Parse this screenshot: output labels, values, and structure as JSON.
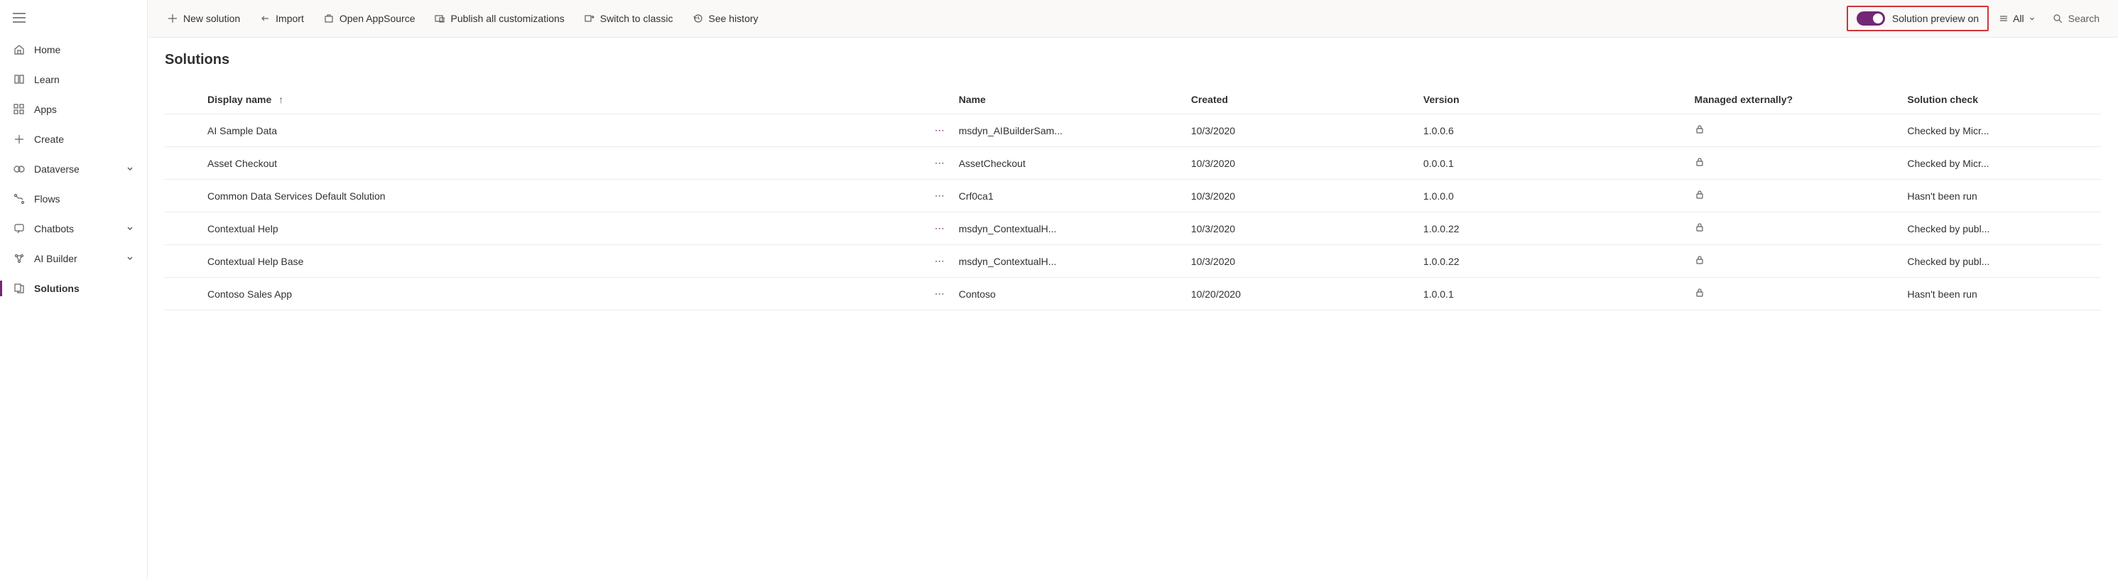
{
  "sidebar": {
    "items": [
      {
        "label": "Home",
        "icon": "home"
      },
      {
        "label": "Learn",
        "icon": "book"
      },
      {
        "label": "Apps",
        "icon": "grid"
      },
      {
        "label": "Create",
        "icon": "plus"
      },
      {
        "label": "Dataverse",
        "icon": "dataverse",
        "expandable": true
      },
      {
        "label": "Flows",
        "icon": "flow"
      },
      {
        "label": "Chatbots",
        "icon": "chat",
        "expandable": true
      },
      {
        "label": "AI Builder",
        "icon": "ai",
        "expandable": true
      },
      {
        "label": "Solutions",
        "icon": "solutions",
        "active": true
      }
    ]
  },
  "toolbar": {
    "new_solution": "New solution",
    "import": "Import",
    "open_appsource": "Open AppSource",
    "publish": "Publish all customizations",
    "switch_classic": "Switch to classic",
    "see_history": "See history",
    "preview_label": "Solution preview on",
    "filter_label": "All",
    "search_placeholder": "Search"
  },
  "page": {
    "title": "Solutions"
  },
  "table": {
    "columns": {
      "display_name": "Display name",
      "name": "Name",
      "created": "Created",
      "version": "Version",
      "managed": "Managed externally?",
      "check": "Solution check"
    },
    "rows": [
      {
        "display": "AI Sample Data",
        "name": "msdyn_AIBuilderSam...",
        "created": "10/3/2020",
        "version": "1.0.0.6",
        "check": "Checked by Micr..."
      },
      {
        "display": "Asset Checkout",
        "name": "AssetCheckout",
        "created": "10/3/2020",
        "version": "0.0.0.1",
        "check": "Checked by Micr..."
      },
      {
        "display": "Common Data Services Default Solution",
        "name": "Crf0ca1",
        "created": "10/3/2020",
        "version": "1.0.0.0",
        "check": "Hasn't been run"
      },
      {
        "display": "Contextual Help",
        "name": "msdyn_ContextualH...",
        "created": "10/3/2020",
        "version": "1.0.0.22",
        "check": "Checked by publ..."
      },
      {
        "display": "Contextual Help Base",
        "name": "msdyn_ContextualH...",
        "created": "10/3/2020",
        "version": "1.0.0.22",
        "check": "Checked by publ..."
      },
      {
        "display": "Contoso Sales App",
        "name": "Contoso",
        "created": "10/20/2020",
        "version": "1.0.0.1",
        "check": "Hasn't been run"
      }
    ]
  }
}
